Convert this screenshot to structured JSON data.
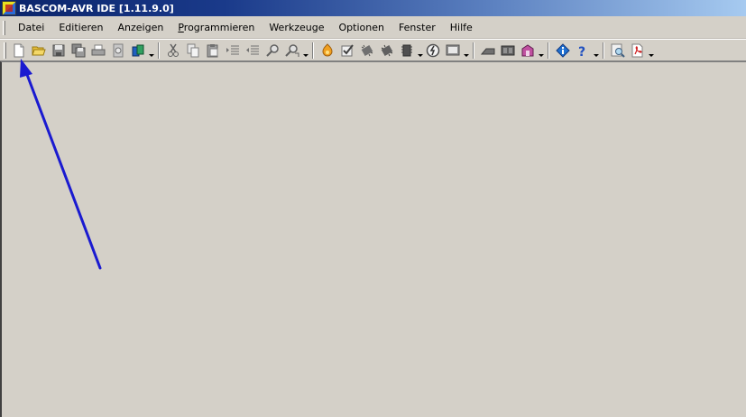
{
  "window": {
    "title": "BASCOM-AVR IDE [1.11.9.0]",
    "icon": "bascom-app-icon"
  },
  "menu": {
    "items": [
      {
        "label": "Datei"
      },
      {
        "label": "Editieren"
      },
      {
        "label": "Anzeigen"
      },
      {
        "label": "Programmieren"
      },
      {
        "label": "Werkzeuge"
      },
      {
        "label": "Optionen"
      },
      {
        "label": "Fenster"
      },
      {
        "label": "Hilfe"
      }
    ]
  },
  "toolbar": {
    "groups": [
      [
        "new-file-icon",
        "open-folder-icon",
        "save-icon",
        "save-all-icon",
        "print-icon",
        "print-preview-icon",
        "export-icon"
      ],
      [
        "cut-icon",
        "copy-icon",
        "paste-icon",
        "indent-icon",
        "outdent-icon",
        "find-icon",
        "find-replace-icon"
      ],
      [
        "compile-icon",
        "syntax-check-icon",
        "chip-icon",
        "chip-program-icon",
        "chip-dropdown-icon",
        "simulator-icon",
        "terminal-icon"
      ],
      [
        "lcd-designer-icon",
        "lib-manager-icon",
        "graphic-converter-icon"
      ],
      [
        "info-icon",
        "help-icon"
      ],
      [
        "web-search-icon",
        "pdf-icon"
      ]
    ]
  },
  "annotation": {
    "color": "#1a1ad0",
    "points_to": "new-file-button"
  }
}
